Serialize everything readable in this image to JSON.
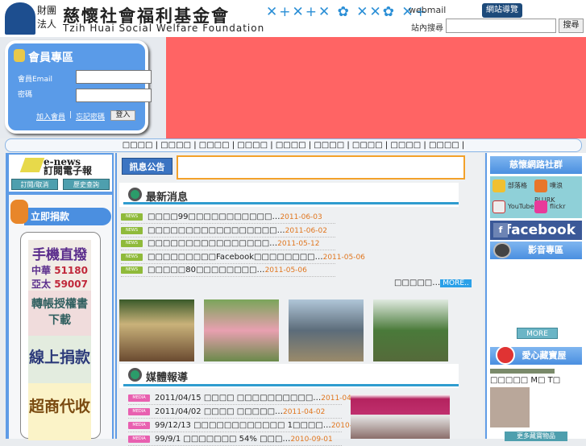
{
  "header": {
    "org_prefix": "財團法人",
    "org_name": "慈懷社會福利基金會",
    "org_en": "Tzih Huai Social Welfare Foundation",
    "decoration": "✕+✕+✕ ✿ ✕✕✿ ✕+",
    "webmail": "webmail",
    "sitemap": "網站導覽",
    "search_label": "站內搜尋",
    "search_value": "",
    "search_button": "搜尋"
  },
  "login": {
    "title": "會員專區",
    "email_label": "會員Email",
    "password_label": "密碼",
    "email_value": "",
    "password_value": "",
    "join": "加入會員",
    "forgot": "忘記密碼",
    "submit": "登入"
  },
  "nav": [
    "□□□□",
    "□□□□",
    "□□□□",
    "□□□□",
    "□□□□",
    "□□□□",
    "□□□□",
    "□□□□",
    "□□□□"
  ],
  "enews": {
    "tag": "e-news",
    "title": "訂閱電子報",
    "subscribe": "訂閱/取消",
    "history": "歷史查詢"
  },
  "donate": {
    "title": "立即捐款",
    "mobile": "手機直撥",
    "cht": "中華",
    "cht_num": "51180",
    "aptg": "亞太",
    "aptg_num": "59007",
    "transfer": "轉帳授權書",
    "download": "下載",
    "online": "線上捐款",
    "store": "超商代收"
  },
  "notice": {
    "label": "訊息公告"
  },
  "news": {
    "title": "最新消息",
    "badge": "NEWS",
    "items": [
      {
        "text": "□□□□99□□□□□□□□□□□…",
        "date": "2011-06-03"
      },
      {
        "text": "□□□□□□□□□□□□□□□□□…",
        "date": "2011-06-02"
      },
      {
        "text": "□□□□□□□□□□□□□□□□…",
        "date": "2011-05-12"
      },
      {
        "text": "□□□□□□□□□Facebook□□□□□□□□…",
        "date": "2011-05-06"
      },
      {
        "text": "□□□□□80□□□□□□□□…",
        "date": "2011-05-06"
      }
    ],
    "more_text": "□□□□□…",
    "more": "MORE.."
  },
  "media": {
    "title": "媒體報導",
    "badge": "MEDIA",
    "items": [
      {
        "text": "2011/04/15 □□□□ □□□□□□□□□□…",
        "date": "2011-04-15"
      },
      {
        "text": "2011/04/02 □□□□ □□□□□…",
        "date": "2011-04-02"
      },
      {
        "text": "99/12/13 □□□□□□□□□□□□ 1□□□□…",
        "date": "2010-12-22"
      },
      {
        "text": "99/9/1 □□□□□□□ 54% □□□…",
        "date": "2010-09-01"
      }
    ]
  },
  "right": {
    "social_title": "慈懷網路社群",
    "blog": "部落格",
    "plurk": "噗浪PLURK",
    "youtube": "YouTube",
    "flickr": "flickr",
    "facebook": "facebook",
    "video_title": "影音專區",
    "more": "MORE",
    "treasure_title": "愛心藏寶屋",
    "treasure_item": "□□□□□ M□ T□",
    "treasure_more": "更多藏寶物品"
  }
}
